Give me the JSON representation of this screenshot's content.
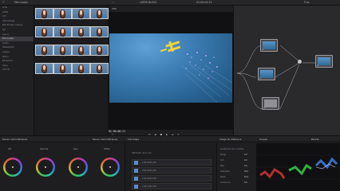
{
  "topbar": {
    "panel_left": "Film Looks",
    "panel_gallery": "",
    "clip_name": "LAPSE BLEU3",
    "timecode_top": "01:00:04:13",
    "nodes_title": "Flux"
  },
  "left_list": {
    "items": [
      "LUTs",
      "ACES",
      "Arri",
      "Astrodesign",
      "Blackmagic Design",
      "DJI",
      "Canon",
      "Film Looks",
      "GoPro",
      "Hasselblad",
      "Legacy",
      "Nikon",
      "Panasonic",
      "Sony",
      "VFX IO"
    ],
    "selected_index": 7
  },
  "gallery": {
    "captions": [
      "LUT 1",
      "LUT 2",
      "LUT 3",
      "LUT 4",
      "LUT 5",
      "LUT 6",
      "LUT 7",
      "LUT 8",
      "LUT 9",
      "LUT 10",
      "LUT 11",
      "LUT 12",
      "LUT 13",
      "LUT 14",
      "LUT 15",
      "LUT 16"
    ]
  },
  "viewer": {
    "timecode": "01:00:08:21",
    "zoom": "30%"
  },
  "nodes": {
    "labels": [
      "01",
      "02",
      "03",
      "04",
      "05"
    ]
  },
  "bottom": {
    "tab_wheels": "Roues colorimétriques",
    "tab_wheels2": "Roues colorimétriques",
    "tab_keyframes": "Clé image",
    "tab_props": "Image de référence",
    "tab_scopes": "Scopes",
    "tab_parade": "Parade",
    "wheels": [
      {
        "name": "Lift",
        "value": "0.00"
      },
      {
        "name": "Gamma",
        "value": "0.00"
      },
      {
        "name": "Gain",
        "value": "1.00"
      },
      {
        "name": "Offset",
        "value": "25.00"
      }
    ],
    "key_header": "Attributs de la clé",
    "key_rows": [
      "1.00  0.00  1.00",
      "0.50  0.00  1.00",
      "1.00  0.00  0.50",
      "1.00  1.00  1.00"
    ],
    "props": [
      {
        "label": "Ajustement des contrôles",
        "value": ""
      },
      {
        "label": "Rouge",
        "value": "0.0"
      },
      {
        "label": "Vert",
        "value": "0.0"
      },
      {
        "label": "Bleu",
        "value": "0.0"
      },
      {
        "label": "Saturation",
        "value": "50.0"
      },
      {
        "label": "Teinte",
        "value": "50.0"
      },
      {
        "label": "Luminance",
        "value": "0.0"
      }
    ]
  }
}
